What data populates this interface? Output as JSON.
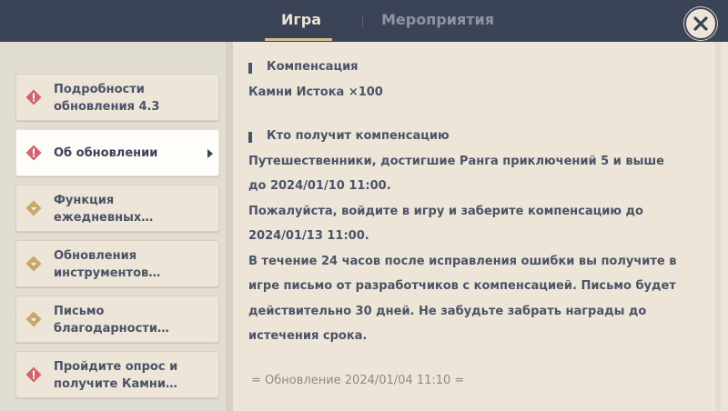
{
  "header": {
    "tabs": [
      {
        "label": "Игра",
        "active": true
      },
      {
        "label": "Мероприятия",
        "active": false
      }
    ]
  },
  "sidebar": {
    "items": [
      {
        "label": "Подробности\nобновления 4.3",
        "icon": "red-diamond-alert-icon",
        "selected": false
      },
      {
        "label": "Об обновлении",
        "icon": "red-diamond-alert-icon",
        "selected": true
      },
      {
        "label": "Функция\nежедневных…",
        "icon": "gold-diamond-icon",
        "selected": false
      },
      {
        "label": "Обновления\nинструментов…",
        "icon": "gold-diamond-icon",
        "selected": false
      },
      {
        "label": "Письмо\nблагодарности…",
        "icon": "gold-diamond-icon",
        "selected": false
      },
      {
        "label": "Пройдите опрос и\nполучите Камни…",
        "icon": "red-diamond-alert-icon",
        "selected": false
      }
    ]
  },
  "content": {
    "section1_heading": "Компенсация",
    "section1_body": "Камни Истока ×100",
    "section2_heading": "Кто получит компенсацию",
    "section2_p1": "Путешественники, достигшие Ранга приключений 5 и выше до 2024/01/10 11:00.",
    "section2_p2": "Пожалуйста, войдите в игру и заберите компенсацию до 2024/01/13 11:00.",
    "section2_p3": "В течение 24 часов после исправления ошибки вы получите в игре письмо от разработчиков с компенсацией. Письмо будет действительно 30 дней. Не забудьте забрать награды до истечения срока.",
    "footer_update": "= Обновление 2024/01/04 11:10 ="
  },
  "colors": {
    "topbar": "#3b4356",
    "accent_gold": "#d3bc8e",
    "alert_red": "#d5636a",
    "gold_icon": "#c9a66b",
    "text": "#4b5366"
  }
}
